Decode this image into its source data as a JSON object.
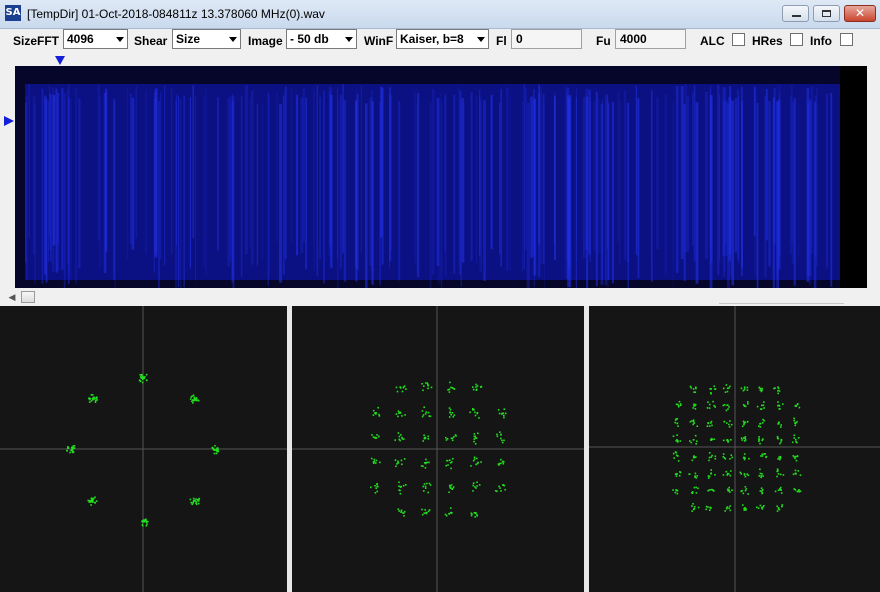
{
  "window": {
    "title": "[TempDir] 01-Oct-2018-084811z 13.378060 MHz(0).wav",
    "app_icon_text": "SA",
    "close_glyph": "✕"
  },
  "toolbar": {
    "sizefft": {
      "label": "SizeFFT",
      "value": "4096"
    },
    "shear": {
      "label": "Shear",
      "value": "Size"
    },
    "image": {
      "label": "Image",
      "value": "- 50 db"
    },
    "winf": {
      "label": "WinF",
      "value": "Kaiser, b=8"
    },
    "fl": {
      "label": "Fl",
      "value": "0"
    },
    "fu": {
      "label": "Fu",
      "value": "4000"
    },
    "alc": {
      "label": "ALC",
      "checked": false
    },
    "hres": {
      "label": "HRes",
      "checked": false
    },
    "info": {
      "label": "Info",
      "checked": false
    }
  },
  "spectrum": {
    "colors": {
      "background": "#05062a",
      "signal": "#2232e8",
      "marker": "#1320d8"
    }
  },
  "scrollbar": {
    "left_arrow_icon": "chevron-left-icon",
    "left_arrow_glyph": "◀"
  },
  "constellations": [
    {
      "name": "8-point",
      "point_color": "#22e01e",
      "points": 8
    },
    {
      "name": "32-point",
      "point_color": "#22e01e",
      "points": 32
    },
    {
      "name": "64-point",
      "point_color": "#22e01e",
      "points": 64
    }
  ]
}
